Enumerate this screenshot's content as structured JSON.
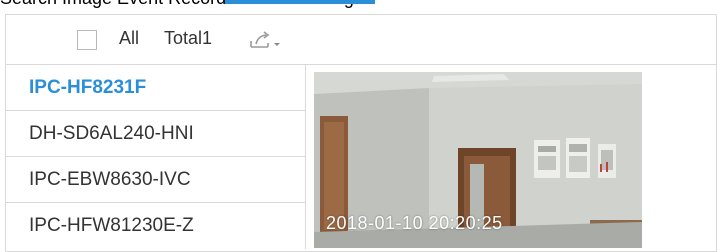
{
  "header": {
    "cut_title": "Search Image    Event Recorder    Video Settings"
  },
  "toolbar": {
    "all_label": "All",
    "total_label": "Total1"
  },
  "devices": [
    {
      "name": "IPC-HF8231F",
      "selected": true
    },
    {
      "name": "DH-SD6AL240-HNI",
      "selected": false
    },
    {
      "name": "IPC-EBW8630-IVC",
      "selected": false
    },
    {
      "name": "IPC-HFW81230E-Z",
      "selected": false
    }
  ],
  "preview": {
    "timestamp": "2018-01-10 20:20:25"
  },
  "colors": {
    "accent": "#2a8fd8",
    "border": "#d9d9d9"
  }
}
